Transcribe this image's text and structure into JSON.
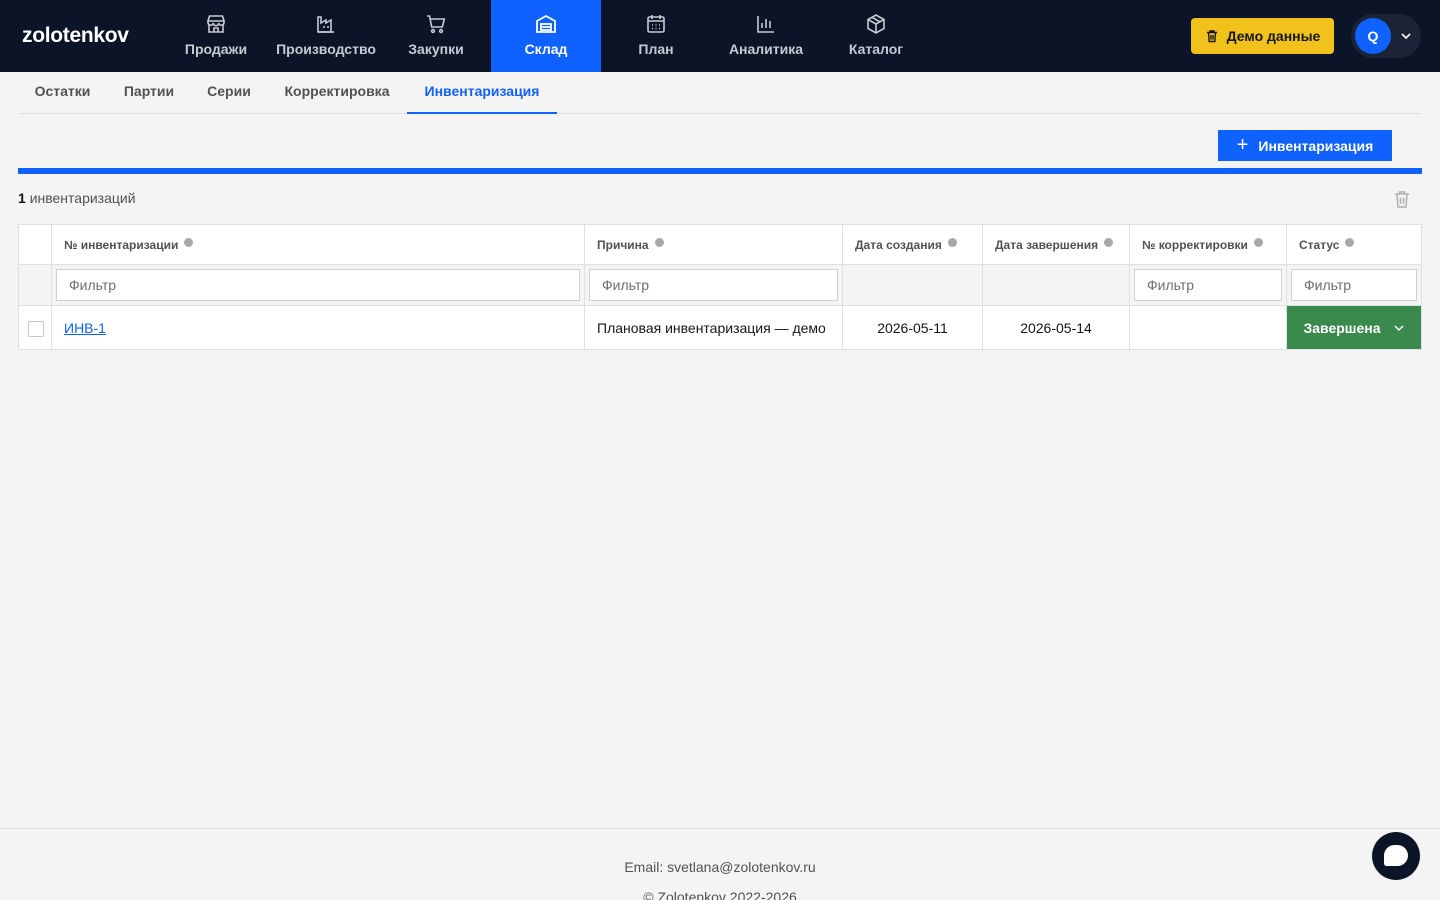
{
  "app": {
    "logo": "zolotenkov"
  },
  "nav": {
    "items": [
      {
        "label": "Продажи",
        "icon": "store-icon"
      },
      {
        "label": "Производство",
        "icon": "factory-icon"
      },
      {
        "label": "Закупки",
        "icon": "cart-icon"
      },
      {
        "label": "Склад",
        "icon": "warehouse-icon",
        "active": true
      },
      {
        "label": "План",
        "icon": "calendar-icon"
      },
      {
        "label": "Аналитика",
        "icon": "bar-chart-icon"
      },
      {
        "label": "Каталог",
        "icon": "box-icon"
      }
    ],
    "demo_label": "Демо данные",
    "avatar_letter": "Q"
  },
  "subtabs": [
    {
      "label": "Остатки"
    },
    {
      "label": "Партии"
    },
    {
      "label": "Серии"
    },
    {
      "label": "Корректировка"
    },
    {
      "label": "Инвентаризация",
      "active": true
    }
  ],
  "toolbar": {
    "add_label": "Инвентаризация"
  },
  "summary": {
    "count": "1",
    "count_label": "инвентаризаций"
  },
  "table": {
    "headers": {
      "number": "№ инвентаризации",
      "reason": "Причина",
      "created": "Дата создания",
      "completed": "Дата завершения",
      "adjustment": "№ корректировки",
      "status": "Статус"
    },
    "filter_placeholder": "Фильтр",
    "rows": [
      {
        "number": "ИНВ-1",
        "reason": "Плановая инвентаризация — демо",
        "created": "2026-05-11",
        "completed": "2026-05-14",
        "adjustment": "",
        "status": "Завершена"
      }
    ]
  },
  "colors": {
    "nav_bg": "#0b1527",
    "accent": "#0f62fe",
    "demo": "#f1c21b",
    "status_done": "#3a8a4e"
  },
  "footer": {
    "email": "Email: svetlana@zolotenkov.ru",
    "copyright": "© Zolotenkov 2022-2026"
  }
}
